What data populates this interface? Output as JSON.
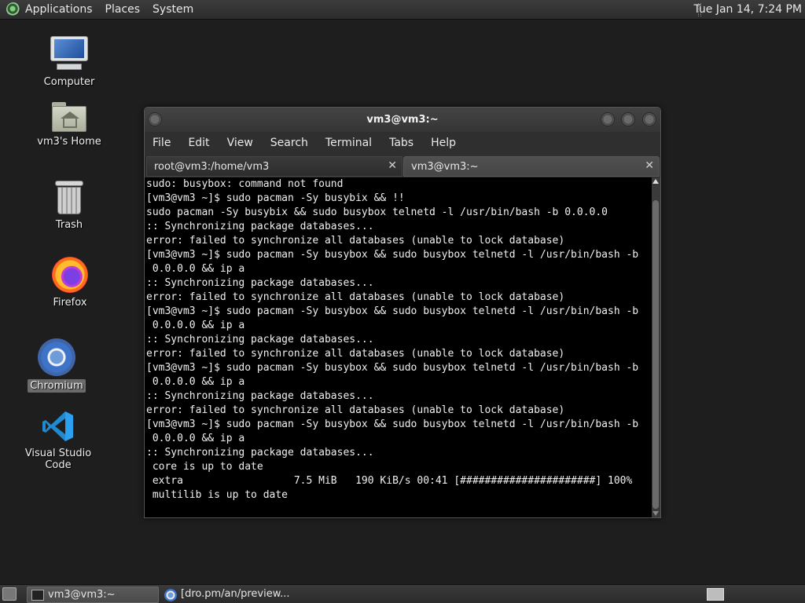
{
  "top_panel": {
    "menus": [
      "Applications",
      "Places",
      "System"
    ],
    "clock": "Tue Jan 14,  7:24 PM"
  },
  "desktop_icons": [
    {
      "label": "Computer",
      "icon": "computer-icon"
    },
    {
      "label": "vm3's Home",
      "icon": "home-folder-icon"
    },
    {
      "label": "Trash",
      "icon": "trash-icon"
    },
    {
      "label": "Firefox",
      "icon": "firefox-icon"
    },
    {
      "label": "Chromium",
      "icon": "chromium-icon",
      "selected": true
    },
    {
      "label": "Visual Studio Code",
      "icon": "vscode-icon"
    }
  ],
  "terminal": {
    "title": "vm3@vm3:~",
    "menu": [
      "File",
      "Edit",
      "View",
      "Search",
      "Terminal",
      "Tabs",
      "Help"
    ],
    "tabs": [
      {
        "label": "root@vm3:/home/vm3",
        "active": false
      },
      {
        "label": "vm3@vm3:~",
        "active": true
      }
    ],
    "lines": [
      "sudo: busybox: command not found",
      "[vm3@vm3 ~]$ sudo pacman -Sy busybix && !!",
      "sudo pacman -Sy busybix && sudo busybox telnetd -l /usr/bin/bash -b 0.0.0.0",
      ":: Synchronizing package databases...",
      "error: failed to synchronize all databases (unable to lock database)",
      "[vm3@vm3 ~]$ sudo pacman -Sy busybox && sudo busybox telnetd -l /usr/bin/bash -b",
      " 0.0.0.0 && ip a",
      ":: Synchronizing package databases...",
      "error: failed to synchronize all databases (unable to lock database)",
      "[vm3@vm3 ~]$ sudo pacman -Sy busybox && sudo busybox telnetd -l /usr/bin/bash -b",
      " 0.0.0.0 && ip a",
      ":: Synchronizing package databases...",
      "error: failed to synchronize all databases (unable to lock database)",
      "[vm3@vm3 ~]$ sudo pacman -Sy busybox && sudo busybox telnetd -l /usr/bin/bash -b",
      " 0.0.0.0 && ip a",
      ":: Synchronizing package databases...",
      "error: failed to synchronize all databases (unable to lock database)",
      "[vm3@vm3 ~]$ sudo pacman -Sy busybox && sudo busybox telnetd -l /usr/bin/bash -b",
      " 0.0.0.0 && ip a",
      ":: Synchronizing package databases...",
      " core is up to date",
      " extra                  7.5 MiB   190 KiB/s 00:41 [######################] 100%",
      " multilib is up to date"
    ]
  },
  "taskbar": {
    "tasks": [
      {
        "label": "vm3@vm3:~",
        "active": true
      },
      {
        "label": "[dro.pm/an/preview...",
        "active": false
      }
    ]
  },
  "colors": {
    "desktop_bg": "#1e1e1e",
    "terminal_bg": "#000000",
    "terminal_fg": "#f0f0f0",
    "selection_bg": "#6b6b6b"
  }
}
